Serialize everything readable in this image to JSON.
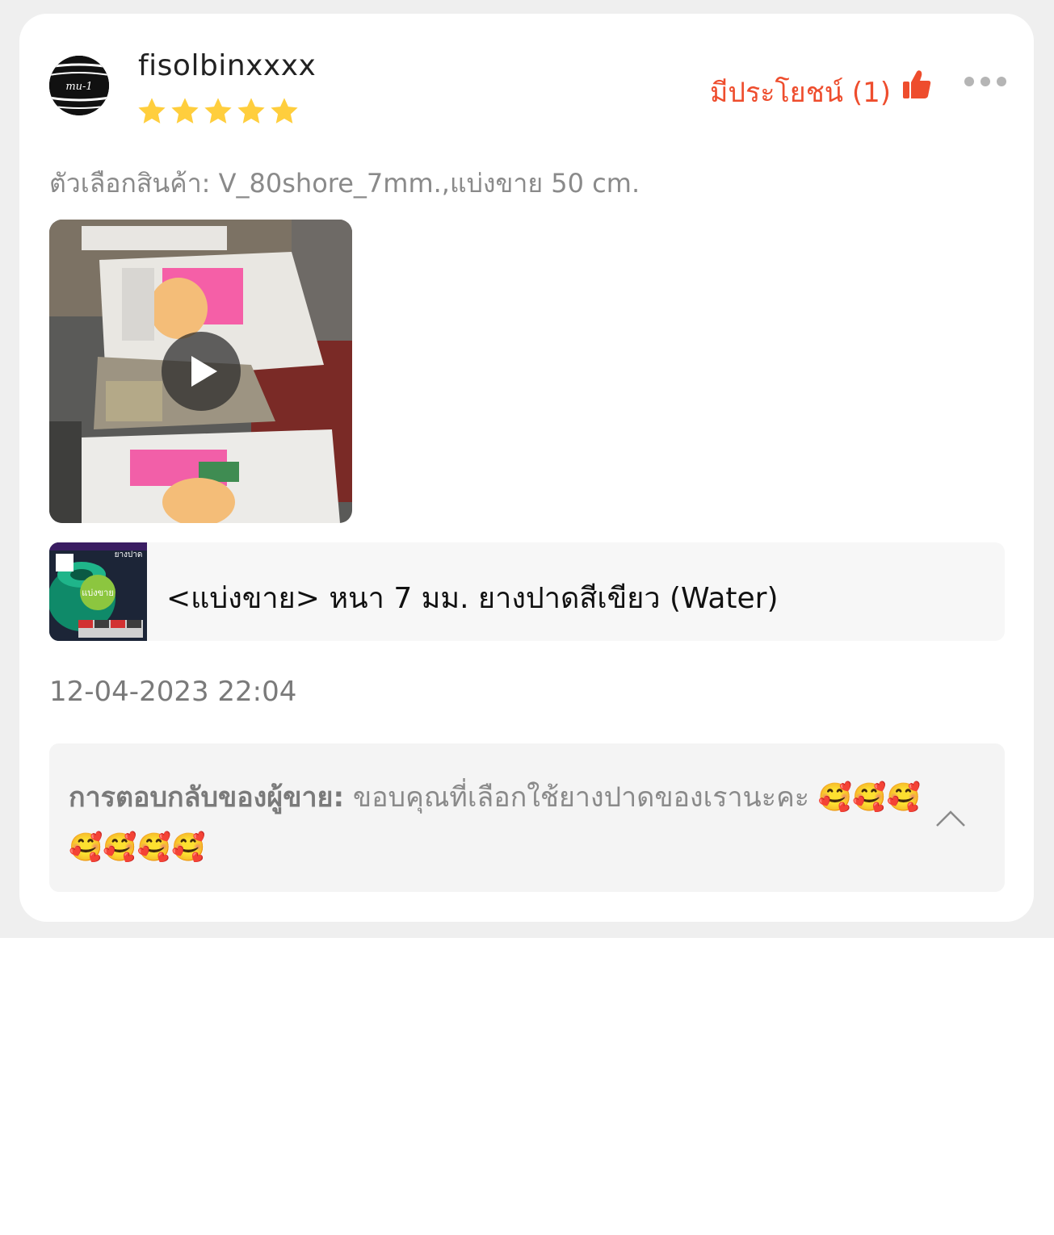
{
  "review": {
    "username": "fisolbinxxxx",
    "rating": 5,
    "helpful_label": "มีประโยชน์ (1)",
    "variation": "ตัวเลือกสินค้า: V_80shore_7mm.,แบ่งขาย 50 cm.",
    "timestamp": "12-04-2023 22:04"
  },
  "product": {
    "name": "<แบ่งขาย> หนา 7 มม. ยางปาดสีเขียว (Water)",
    "thumb_title": "ยางปาด",
    "thumb_badge": "แบ่งขาย"
  },
  "seller_reply": {
    "label": "การตอบกลับของผู้ขาย:",
    "text": " ขอบคุณที่เลือกใช้ยางปาดของเรานะคะ 🥰🥰🥰🥰🥰🥰🥰"
  },
  "icons": {
    "star": "star-icon",
    "thumb": "thumbs-up-icon",
    "more": "more-options-icon",
    "play": "play-icon",
    "collapse": "chevron-up-icon"
  },
  "colors": {
    "accent": "#ee4d2d",
    "star": "#ffce3d",
    "muted_text": "#8a8a8a"
  }
}
